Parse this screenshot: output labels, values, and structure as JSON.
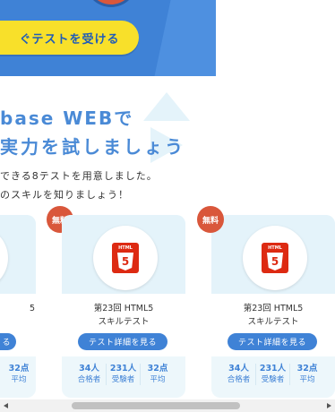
{
  "hero": {
    "cta_label": "ぐテストを受ける"
  },
  "headline": {
    "line1": "base WEBで",
    "line2": "実力を試しましょう",
    "sub1": "できる8テストを用意しました。",
    "sub2": "のスキルを知りましょう！"
  },
  "cards": [
    {
      "badge": "",
      "title1": "5",
      "title2": "",
      "button": "る",
      "stats": [
        {
          "n": "32点",
          "l": "平均"
        }
      ]
    },
    {
      "badge": "無料",
      "logo_text": "HTML",
      "logo_num": "5",
      "title1": "第23回 HTML5",
      "title2": "スキルテスト",
      "button": "テスト詳細を見る",
      "stats": [
        {
          "n": "34人",
          "l": "合格者"
        },
        {
          "n": "231人",
          "l": "受験者"
        },
        {
          "n": "32点",
          "l": "平均"
        }
      ]
    },
    {
      "badge": "無料",
      "logo_text": "HTML",
      "logo_num": "5",
      "title1": "第23回 HTML5",
      "title2": "スキルテスト",
      "button": "テスト詳細を見る",
      "stats": [
        {
          "n": "34人",
          "l": "合格者"
        },
        {
          "n": "231人",
          "l": "受験者"
        },
        {
          "n": "32点",
          "l": "平均"
        }
      ]
    }
  ],
  "first_badge": "無料"
}
